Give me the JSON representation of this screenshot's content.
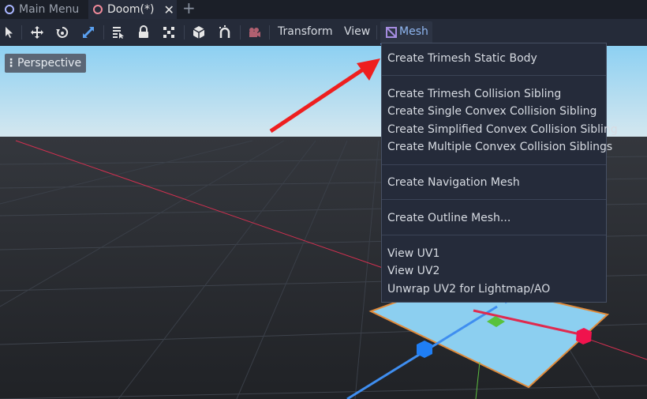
{
  "tabs": [
    {
      "label": "Main Menu",
      "circle_color": "#a9b5ff"
    },
    {
      "label": "Doom(*)",
      "circle_color": "#f08a9a",
      "close": "✕"
    }
  ],
  "tab_add": "+",
  "toolbar": {
    "tools": [
      "select-icon",
      "move-icon",
      "rotate-icon",
      "scale-icon",
      "list-select-icon",
      "lock-icon",
      "group-icon",
      "local-space-icon",
      "snap-icon",
      "camera-icon"
    ],
    "menus": {
      "transform": "Transform",
      "view": "View",
      "mesh": "Mesh"
    }
  },
  "viewport": {
    "perspective_label": "Perspective",
    "sky_color": "#8ecdf0",
    "ground_color": "#2b2e33"
  },
  "mesh_menu": {
    "groups": [
      [
        "Create Trimesh Static Body"
      ],
      [
        "Create Trimesh Collision Sibling",
        "Create Single Convex Collision Sibling",
        "Create Simplified Convex Collision Sibling",
        "Create Multiple Convex Collision Siblings"
      ],
      [
        "Create Navigation Mesh"
      ],
      [
        "Create Outline Mesh..."
      ],
      [
        "View UV1",
        "View UV2",
        "Unwrap UV2 for Lightmap/AO"
      ]
    ]
  }
}
